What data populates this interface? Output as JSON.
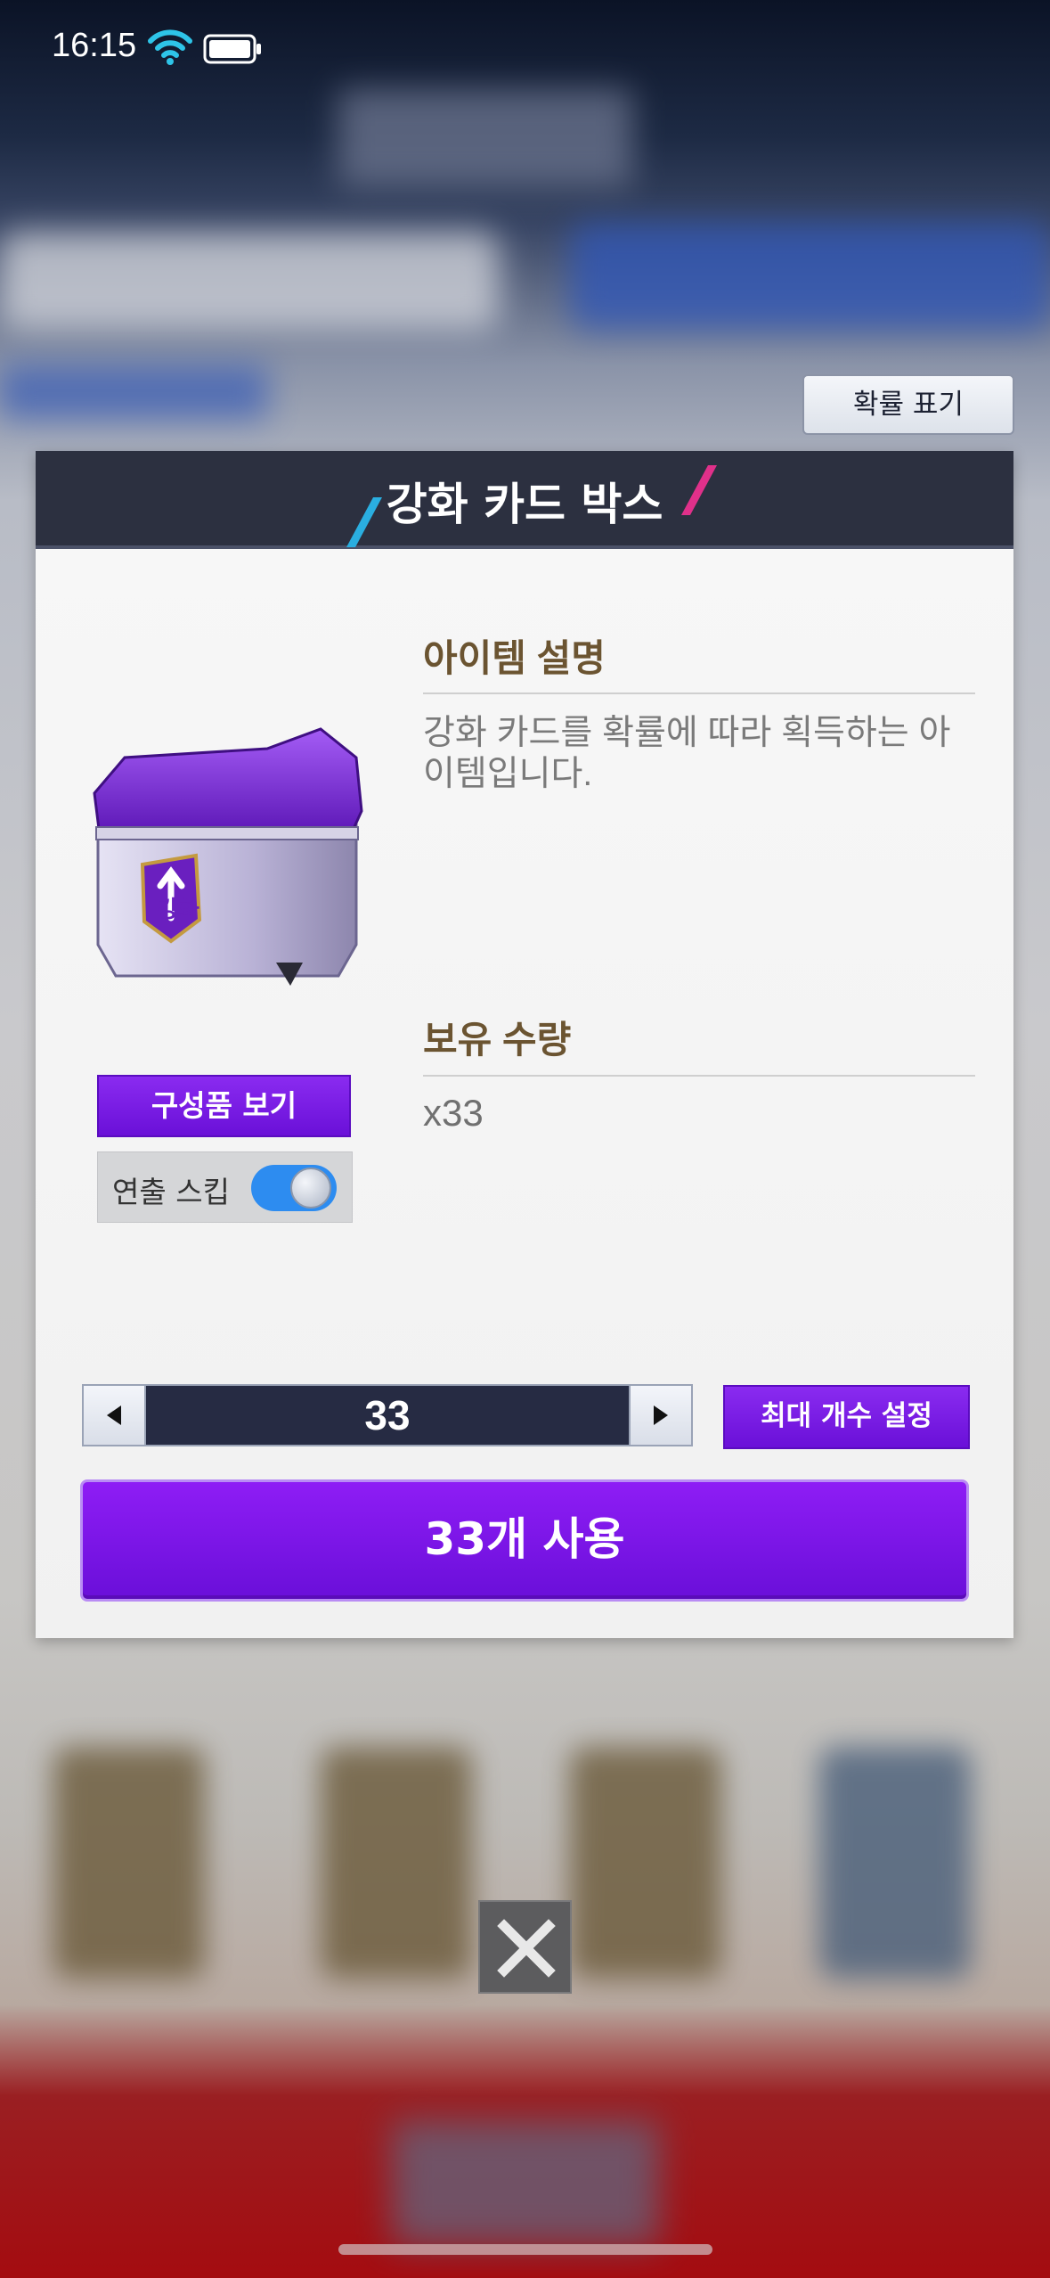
{
  "status_bar": {
    "time": "16:15",
    "wifi_icon": "wifi-icon",
    "battery_icon": "battery-icon"
  },
  "probability_button": {
    "label": "확률 표기"
  },
  "dialog": {
    "title": "강화 카드 박스",
    "item_icon": "enhancement-card-box-icon",
    "item_icon_caption": "강화",
    "description_heading": "아이템 설명",
    "description_text": "강화 카드를 확률에 따라 획득하는 아이템입니다.",
    "owned_heading": "보유 수량",
    "owned_count": "x33",
    "components_button": "구성품 보기",
    "skip_label": "연출 스킵",
    "skip_enabled": true,
    "quantity": "33",
    "max_button": "최대 개수 설정",
    "use_button": "33개 사용"
  },
  "colors": {
    "accent_purple": "#7a14e6",
    "header_dark": "#2c3040",
    "toggle_blue": "#2d8cf0",
    "heading_brown": "#6b5431"
  }
}
